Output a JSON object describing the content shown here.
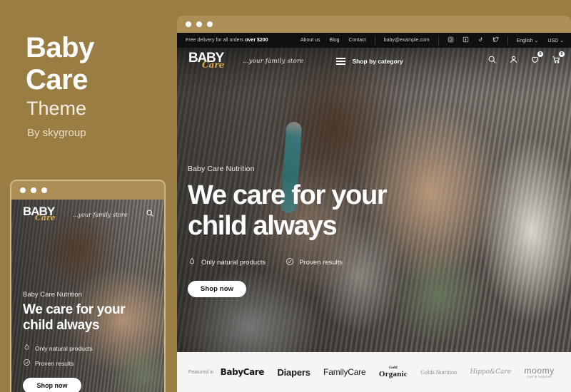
{
  "promo": {
    "title_line1": "Baby",
    "title_line2": "Care",
    "subtitle": "Theme",
    "author": "By skygroup",
    "background_color": "#9a7d43"
  },
  "window": {
    "dots_count": 3,
    "titlebar_color": "#ab8f56"
  },
  "site": {
    "topbar": {
      "promo_prefix": "Free delivery for all orders ",
      "promo_bold": "over $200",
      "nav": [
        "About us",
        "Blog",
        "Contact"
      ],
      "email": "baby@example.com",
      "social": [
        "instagram-icon",
        "facebook-icon",
        "tiktok-icon",
        "twitter-icon"
      ],
      "language": "English",
      "currency": "USD"
    },
    "header": {
      "logo_main": "BABY",
      "logo_accent": "Care",
      "tagline": "...your family store",
      "category_label": "Shop by category",
      "icons": [
        "search-icon",
        "account-icon",
        "wishlist-icon",
        "cart-icon"
      ],
      "wishlist_count": "0",
      "cart_count": "0"
    },
    "hero": {
      "eyebrow": "Baby Care Nutrition",
      "headline_line1": "We care for your",
      "headline_line2": "child always",
      "features": [
        {
          "icon": "leaf-icon",
          "label": "Only natural products"
        },
        {
          "icon": "check-circle-icon",
          "label": "Proven results"
        }
      ],
      "cta": "Shop now"
    },
    "brands": {
      "featured_label": "Featured in",
      "items": [
        {
          "name": "BabyCare"
        },
        {
          "name": "Diapers"
        },
        {
          "name": "FamilyCare"
        },
        {
          "name": "Organic",
          "top": "Gold"
        },
        {
          "name": "Golda Nutrition"
        },
        {
          "name": "Hippo&Care"
        },
        {
          "name": "moomy",
          "sub": "toys & supplies"
        }
      ]
    }
  },
  "mobile": {
    "logo_main": "BABY",
    "logo_accent": "Care",
    "tagline": "...your family store",
    "search_icon": "search-icon",
    "eyebrow": "Baby Care Nutrition",
    "headline_line1": "We care for your",
    "headline_line2": "child always",
    "features": [
      {
        "icon": "leaf-icon",
        "label": "Only natural products"
      },
      {
        "icon": "check-circle-icon",
        "label": "Proven results"
      }
    ],
    "cta": "Shop now"
  }
}
